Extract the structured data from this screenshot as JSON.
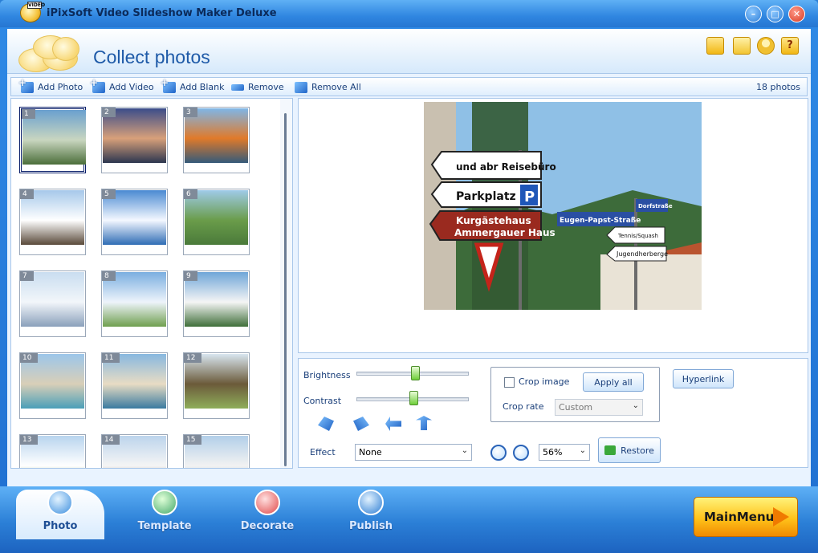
{
  "window": {
    "title": "iPixSoft Video Slideshow Maker Deluxe",
    "icon_badge": "VIDEO"
  },
  "header": {
    "title": "Collect photos",
    "icons": [
      "folder-icon",
      "save-icon",
      "user-icon",
      "help-icon"
    ],
    "help_glyph": "?"
  },
  "toolbar": {
    "add_photo": "Add Photo",
    "add_video": "Add Video",
    "add_blank": "Add Blank",
    "remove": "Remove",
    "remove_all": "Remove All",
    "photo_count": "18 photos"
  },
  "thumbnails": [
    {
      "num": "1",
      "selected": true
    },
    {
      "num": "2"
    },
    {
      "num": "3"
    },
    {
      "num": "4"
    },
    {
      "num": "5"
    },
    {
      "num": "6"
    },
    {
      "num": "7"
    },
    {
      "num": "8"
    },
    {
      "num": "9"
    },
    {
      "num": "10"
    },
    {
      "num": "11"
    },
    {
      "num": "12"
    },
    {
      "num": "13"
    },
    {
      "num": "14"
    },
    {
      "num": "15"
    }
  ],
  "preview": {
    "signs": [
      "und abr Reisebüro",
      "Parkplatz",
      "P",
      "Kurgästehaus",
      "Ammergauer Haus",
      "Eugen-Papst-Straße",
      "Dorfstraße",
      "Tennis/Squash",
      "Jugendherberge"
    ]
  },
  "controls": {
    "brightness_label": "Brightness",
    "contrast_label": "Contrast",
    "brightness_value": 0.52,
    "contrast_value": 0.51,
    "effect_label": "Effect",
    "effect_value": "None",
    "crop_image_label": "Crop image",
    "apply_all_label": "Apply all",
    "crop_rate_label": "Crop rate",
    "crop_rate_value": "Custom",
    "hyperlink_label": "Hyperlink",
    "zoom_value": "56%",
    "restore_label": "Restore"
  },
  "bottom_nav": {
    "photo": "Photo",
    "template": "Template",
    "decorate": "Decorate",
    "publish": "Publish",
    "main_menu": "MainMenu"
  },
  "colors": {
    "accent": "#2b7fd6",
    "panel_bg": "#e9f3ff",
    "selected_border": "#0a1f6a",
    "main_menu": "#ffc21a"
  }
}
